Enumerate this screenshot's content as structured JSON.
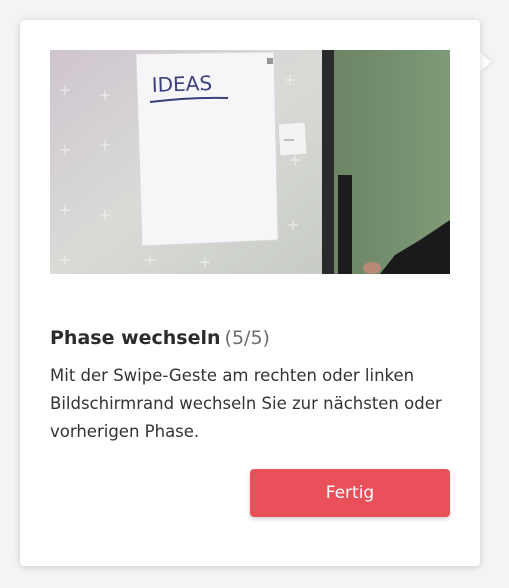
{
  "tutorial": {
    "image": {
      "board_text": "IDEAS"
    },
    "title": "Phase wechseln",
    "step": "(5/5)",
    "description": "Mit der Swipe-Geste am rechten oder linken Bildschirmrand wechseln Sie zur nächsten oder vorherigen Phase.",
    "done_label": "Fertig"
  },
  "colors": {
    "accent": "#e9505a",
    "title": "#2b2b2b",
    "step": "#6d6d6d"
  }
}
